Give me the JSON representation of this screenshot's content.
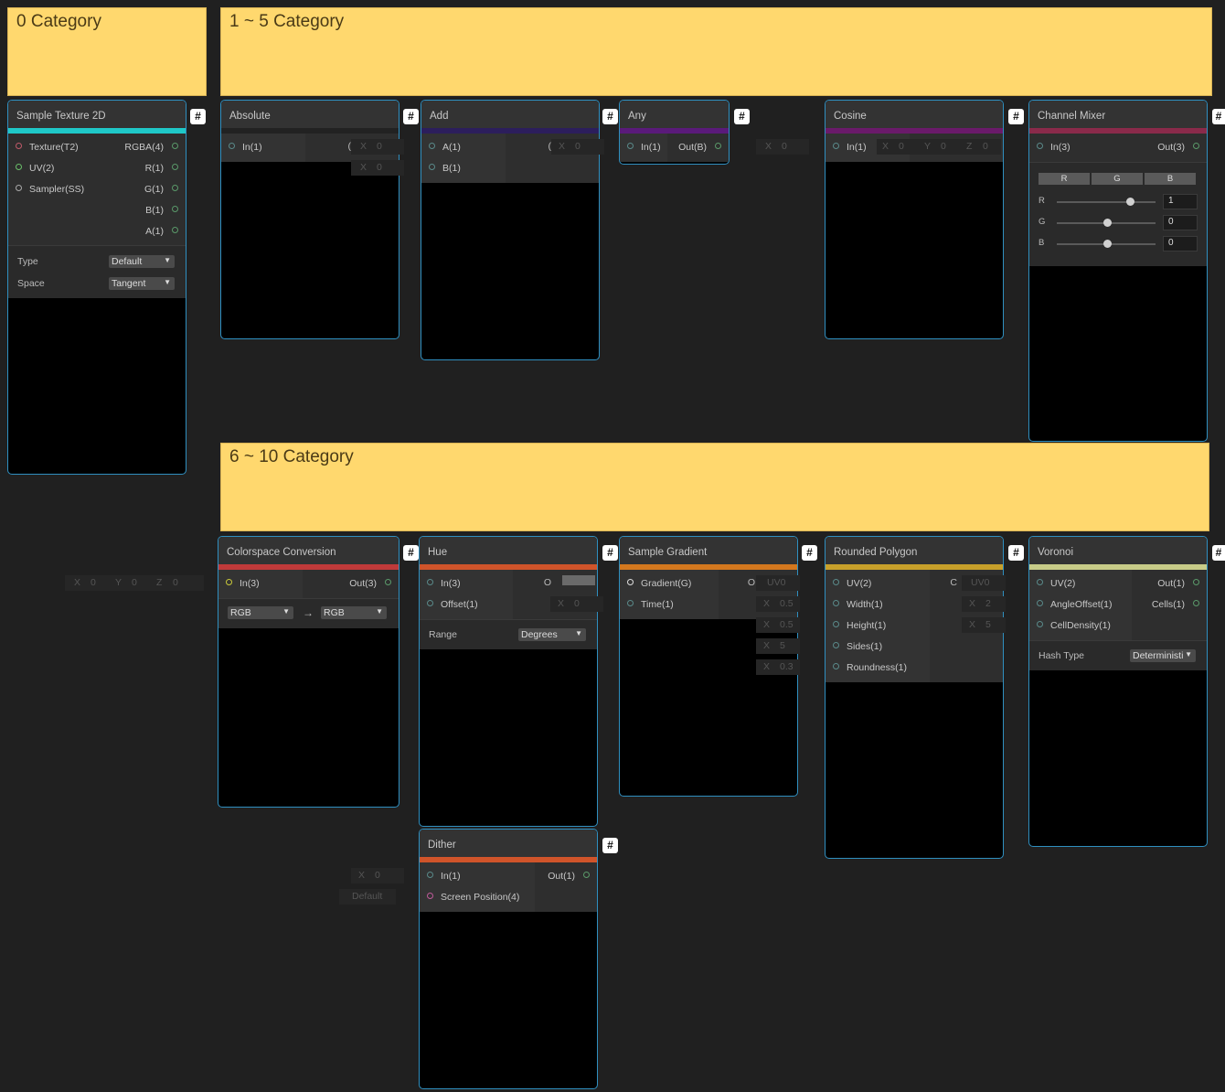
{
  "stickies": {
    "cat0": "0 Category",
    "cat1_5": "1 ~ 5 Category",
    "cat6_10": "6 ~ 10 Category"
  },
  "hash_label": "#",
  "nodes": {
    "sample_texture": {
      "title": "Sample Texture 2D",
      "inputs": [
        "Texture(T2)",
        "UV(2)",
        "Sampler(SS)"
      ],
      "outputs": [
        "RGBA(4)",
        "R(1)",
        "G(1)",
        "B(1)",
        "A(1)"
      ],
      "type_label": "Type",
      "type_value": "Default",
      "space_label": "Space",
      "space_value": "Tangent"
    },
    "absolute": {
      "title": "Absolute",
      "input": "In(1)",
      "out_partial": "("
    },
    "add": {
      "title": "Add",
      "inputs": [
        "A(1)",
        "B(1)"
      ],
      "out_partial": "("
    },
    "any": {
      "title": "Any",
      "input": "In(1)",
      "output": "Out(B)"
    },
    "cosine": {
      "title": "Cosine",
      "input": "In(1)"
    },
    "channel_mixer": {
      "title": "Channel Mixer",
      "input": "In(3)",
      "output": "Out(3)",
      "tabs": [
        "R",
        "G",
        "B"
      ],
      "rows": [
        {
          "label": "R",
          "value": "1"
        },
        {
          "label": "G",
          "value": "0"
        },
        {
          "label": "B",
          "value": "0"
        }
      ]
    },
    "colorspace": {
      "title": "Colorspace Conversion",
      "input": "In(3)",
      "output": "Out(3)",
      "from": "RGB",
      "arrow": "→",
      "to": "RGB"
    },
    "hue": {
      "title": "Hue",
      "inputs": [
        "In(3)",
        "Offset(1)"
      ],
      "out_partial": "O",
      "range_label": "Range",
      "range_value": "Degrees"
    },
    "sample_gradient": {
      "title": "Sample Gradient",
      "inputs": [
        "Gradient(G)",
        "Time(1)"
      ],
      "out_partial": "O"
    },
    "rounded_polygon": {
      "title": "Rounded Polygon",
      "inputs": [
        "UV(2)",
        "Width(1)",
        "Height(1)",
        "Sides(1)",
        "Roundness(1)"
      ],
      "out_partial": "C"
    },
    "voronoi": {
      "title": "Voronoi",
      "inputs": [
        "UV(2)",
        "AngleOffset(1)",
        "CellDensity(1)"
      ],
      "outputs": [
        "Out(1)",
        "Cells(1)"
      ],
      "hash_label": "Hash Type",
      "hash_value": "Deterministi"
    },
    "dither": {
      "title": "Dither",
      "inputs": [
        "In(1)",
        "Screen Position(4)"
      ],
      "output": "Out(1)"
    }
  },
  "fields": {
    "x": "X",
    "y": "Y",
    "z": "Z",
    "zero": "0",
    "uv0": "UV0",
    "half": "0.5",
    "five": "5",
    "point3": "0.3",
    "two": "2",
    "default": "Default"
  },
  "colors": {
    "sample_texture": "#1fc8c8",
    "absolute": "#222222",
    "add": "#2c1e5c",
    "any": "#5a1a7a",
    "cosine": "#6a1a6a",
    "channel_mixer": "#8a2a4a",
    "colorspace": "#c03a3a",
    "hue": "#d0542a",
    "sample_gradient": "#d4781e",
    "rounded_polygon": "#c8a02a",
    "voronoi": "#c8cc88",
    "dither": "#d0542a"
  }
}
